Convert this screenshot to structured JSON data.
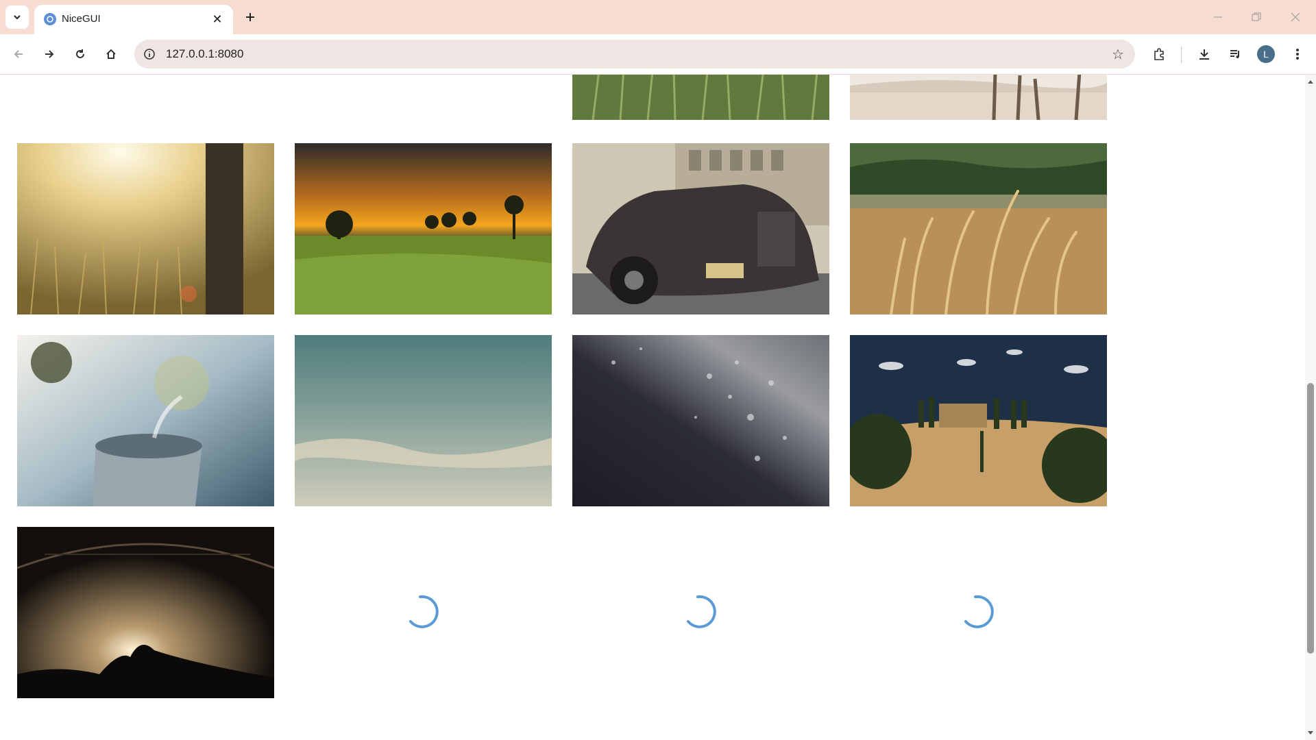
{
  "browser": {
    "tab_title": "NiceGUI",
    "url": "127.0.0.1:8080",
    "profile_initial": "L",
    "icons": [
      "tab-list-icon",
      "nicegui-favicon",
      "close-icon",
      "plus-icon",
      "minimize-icon",
      "restore-icon",
      "window-close-icon",
      "back-icon",
      "forward-icon",
      "reload-icon",
      "home-icon",
      "site-info-icon",
      "star-icon",
      "extensions-icon",
      "download-icon",
      "media-control-icon",
      "menu-icon"
    ]
  },
  "gallery": {
    "images": [
      {
        "subject": "wheat field close-up (partially scrolled out)"
      },
      {
        "subject": "beach with palm trees (partially scrolled out)"
      },
      {
        "subject": "sunlit meadow beside tree trunk"
      },
      {
        "subject": "sunset over green field with trees"
      },
      {
        "subject": "vintage black car on street"
      },
      {
        "subject": "golden grass in wind"
      },
      {
        "subject": "steaming cup by window"
      },
      {
        "subject": "cloudy teal sky"
      },
      {
        "subject": "water droplets on dark glass"
      },
      {
        "subject": "tuscan farmhouse with cypress trees"
      },
      {
        "subject": "concert crowd under stage lights"
      }
    ],
    "loading_count": 3
  },
  "colors": {
    "tabbar_bg": "#f7dcd1",
    "spinner": "#5b9bd5"
  }
}
